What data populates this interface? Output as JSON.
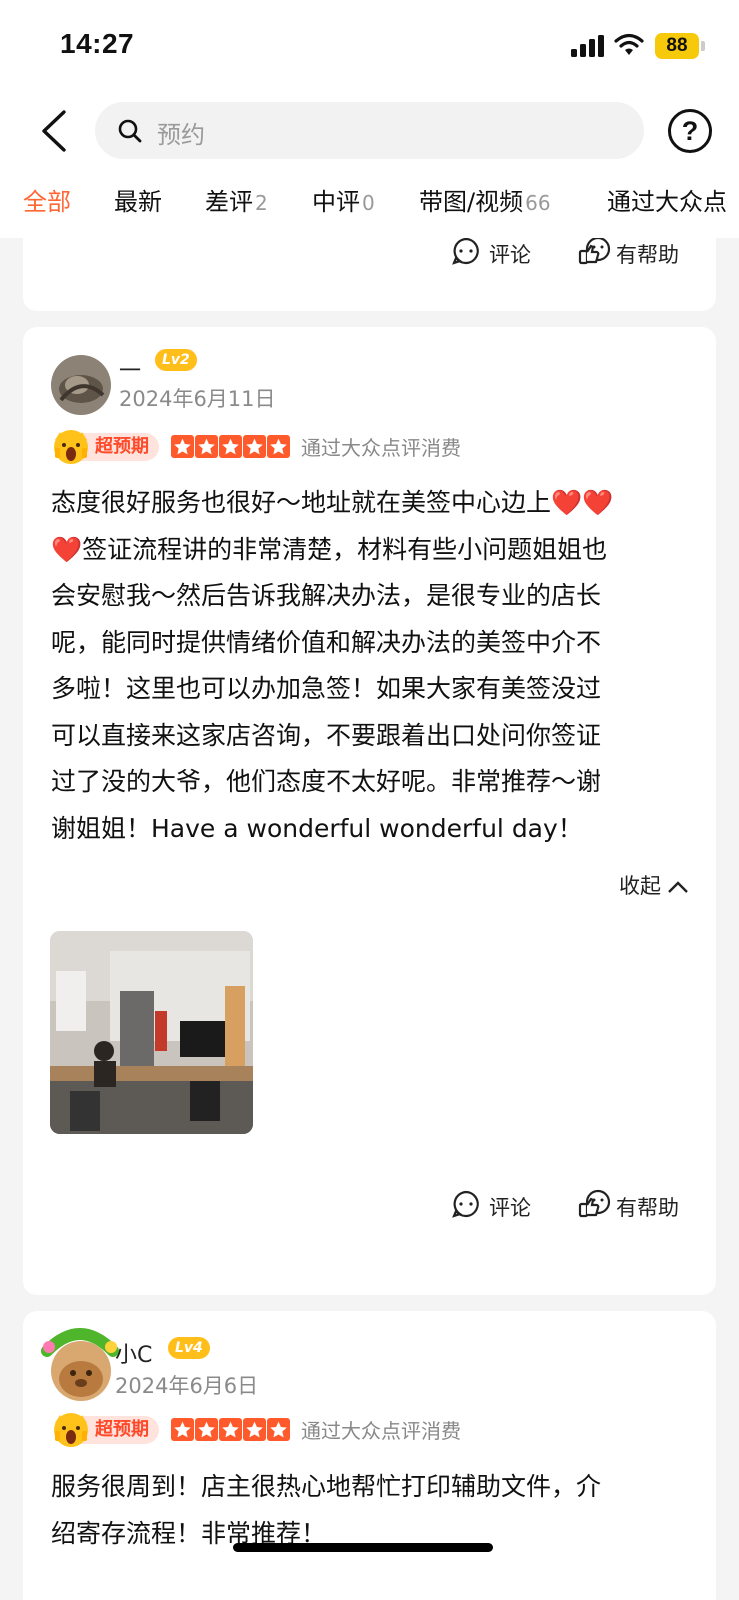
{
  "status_bar": {
    "time": "14:27",
    "battery": "88"
  },
  "search": {
    "placeholder": "预约"
  },
  "tabs": [
    {
      "label": "全部",
      "count": ""
    },
    {
      "label": "最新",
      "count": ""
    },
    {
      "label": "差评",
      "count": "2"
    },
    {
      "label": "中评",
      "count": "0"
    },
    {
      "label": "带图/视频",
      "count": "66"
    },
    {
      "label": "通过大众点",
      "count": ""
    }
  ],
  "actions": {
    "comment": "评论",
    "helpful": "有帮助"
  },
  "reviews": [
    {
      "username": "一",
      "level": "Lv2",
      "date": "2024年6月11日",
      "tag": "超预期",
      "stars": 5,
      "verify": "通过大众点评消费",
      "lines": [
        "态度很好服务也很好～地址就在美签中心边上❤️❤️",
        "❤️签证流程讲的非常清楚，材料有些小问题姐姐也",
        "会安慰我～然后告诉我解决办法，是很专业的店长",
        "呢，能同时提供情绪价值和解决办法的美签中介不",
        "多啦！这里也可以办加急签！如果大家有美签没过",
        "可以直接来这家店咨询，不要跟着出口处问你签证",
        "过了没的大爷，他们态度不太好呢。非常推荐～谢",
        "谢姐姐！Have a wonderful wonderful day！"
      ],
      "collapse": "收起"
    },
    {
      "username": "小C",
      "level": "Lv4",
      "avatar_frame": "四季收藏师",
      "date": "2024年6月6日",
      "tag": "超预期",
      "stars": 5,
      "verify": "通过大众点评消费",
      "lines": [
        "服务很周到！店主很热心地帮忙打印辅助文件，介",
        "绍寄存流程！非常推荐！"
      ]
    }
  ],
  "colors": {
    "accent": "#ff6633",
    "star": "#ff5a2c",
    "tag_bg": "#ffe3dc",
    "level": "#ffbe1a"
  }
}
